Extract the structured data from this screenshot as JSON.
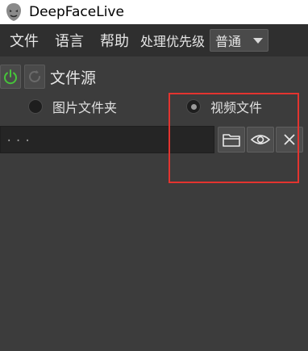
{
  "window": {
    "title": "DeepFaceLive"
  },
  "menu": {
    "items": [
      {
        "label": "文件"
      },
      {
        "label": "语言"
      },
      {
        "label": "帮助"
      }
    ],
    "priority_label": "处理优先级",
    "priority_value": "普通"
  },
  "source": {
    "title": "文件源",
    "radio_options": [
      {
        "label": "图片文件夹",
        "selected": false
      },
      {
        "label": "视频文件",
        "selected": true
      }
    ],
    "path_value": "..."
  },
  "colors": {
    "background": "#3c3c3c",
    "menubar": "#2f2f2f",
    "power_green": "#46c43a",
    "highlight_red": "#e3342f"
  },
  "icons": [
    "app-logo-icon",
    "power-icon",
    "reload-icon",
    "folder-icon",
    "eye-icon",
    "close-icon",
    "chevron-down-icon"
  ]
}
